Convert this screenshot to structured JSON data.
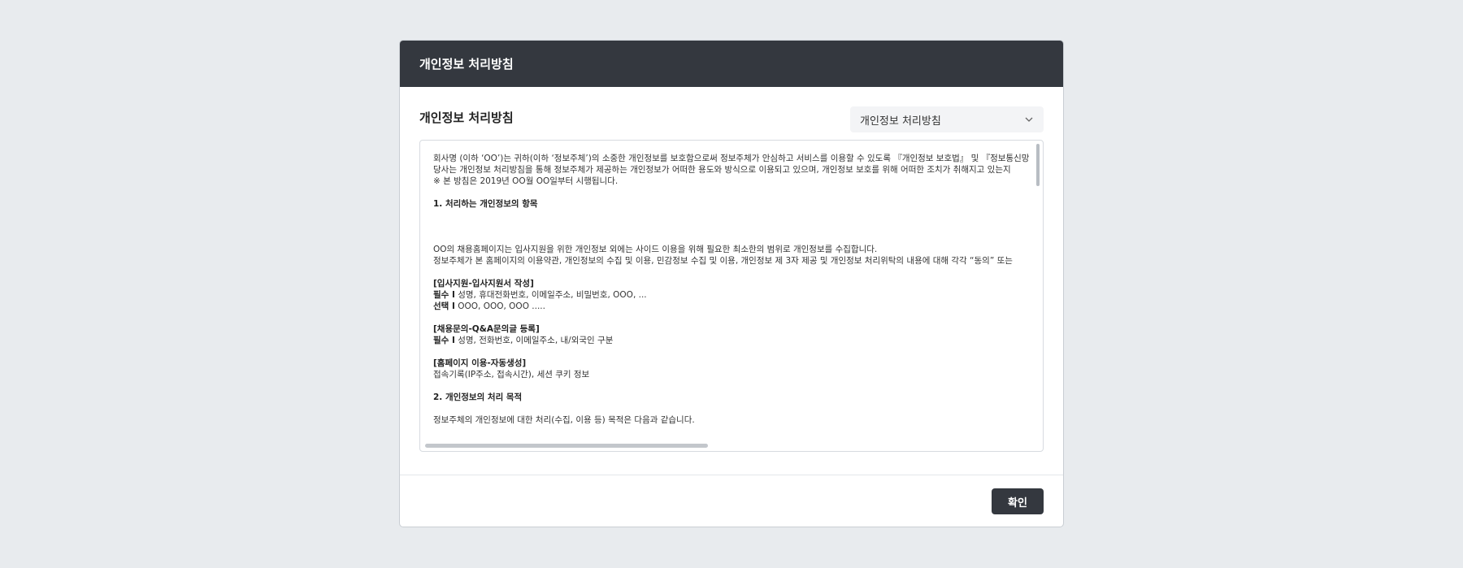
{
  "modal": {
    "title": "개인정보 처리방침"
  },
  "body": {
    "title": "개인정보 처리방침",
    "select": {
      "value": "개인정보 처리방침"
    }
  },
  "policy": {
    "intro": [
      "회사명 (이하 ‘OO’)는 귀하(이하 ‘정보주체’)의 소중한 개인정보를 보호함으로써 정보주체가 안심하고 서비스를 이용할 수 있도록 『개인정보 보호법』 및 『정보통신망",
      "당사는 개인정보 처리방침을 통해 정보주체가 제공하는 개인정보가 어떠한 용도와 방식으로 이용되고 있으며, 개인정보 보호를 위해 어떠한 조치가 취해지고 있는지",
      "※ 본 방침은 2019년 OO월 OO일부터 시행됩니다."
    ],
    "section1_title": "1. 처리하는 개인정보의 항목",
    "section1_lines": [
      "OO의 채용홈페이지는 입사지원을 위한 개인정보 외에는 사이드 이용을 위해 필요한 최소한의 범위로 개인정보를 수집합니다.",
      "정보주체가 본 홈페이지의 이용약관, 개인정보의 수집 및 이용, 민감정보 수집 및 이용, 개인정보 제 3자 제공 및 개인정보 처리위탁의 내용에 대해 각각 “동의” 또는"
    ],
    "groups": [
      {
        "heading": "[입사지원-입사지원서 작성]",
        "rows": [
          {
            "label": "필수 I",
            "text": " 성명, 휴대전화번호, 이메일주소, 비밀번호, OOO, ..."
          },
          {
            "label": "선택 I",
            "text": " OOO, OOO, OOO ....."
          }
        ]
      },
      {
        "heading": "[채용문의-Q&A문의글 등록]",
        "rows": [
          {
            "label": "필수 I",
            "text": " 성명, 전화번호, 이메일주소, 내/외국인 구분"
          }
        ]
      },
      {
        "heading": "[홈페이지 이용-자동생성]",
        "rows": [
          {
            "label": "",
            "text": "접속기록(IP주소, 접속시간), 세션 쿠키 정보"
          }
        ]
      }
    ],
    "section2_title": "2. 개인정보의 처리 목적",
    "section2_line": "정보주체의 개인정보에 대한 처리(수집, 이용 등) 목적은 다음과 같습니다."
  },
  "footer": {
    "confirm_label": "확인"
  }
}
